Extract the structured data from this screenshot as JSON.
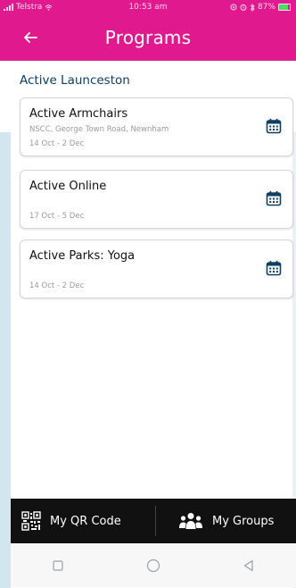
{
  "status": {
    "carrier": "Telstra",
    "time": "10:53 am",
    "battery": "87%"
  },
  "header": {
    "title": "Programs",
    "back_icon": "arrow-left-icon"
  },
  "section": {
    "title": "Active Launceston"
  },
  "programs": [
    {
      "title": "Active Armchairs",
      "location": "NSCC, George Town Road, Newnham",
      "dates": "14 Oct - 2 Dec",
      "icon": "calendar-icon"
    },
    {
      "title": "Active Online",
      "location": "",
      "dates": "17 Oct - 5 Dec",
      "icon": "calendar-icon"
    },
    {
      "title": "Active Parks: Yoga",
      "location": "",
      "dates": "14 Oct - 2 Dec",
      "icon": "calendar-icon"
    }
  ],
  "bottom_nav": {
    "qr_label": "My QR Code",
    "groups_label": "My Groups"
  },
  "colors": {
    "header_bg": "#e0198f",
    "title_blue": "#0e3f63",
    "calendar_blue": "#0e3f63",
    "bottom_bar": "#111111"
  }
}
